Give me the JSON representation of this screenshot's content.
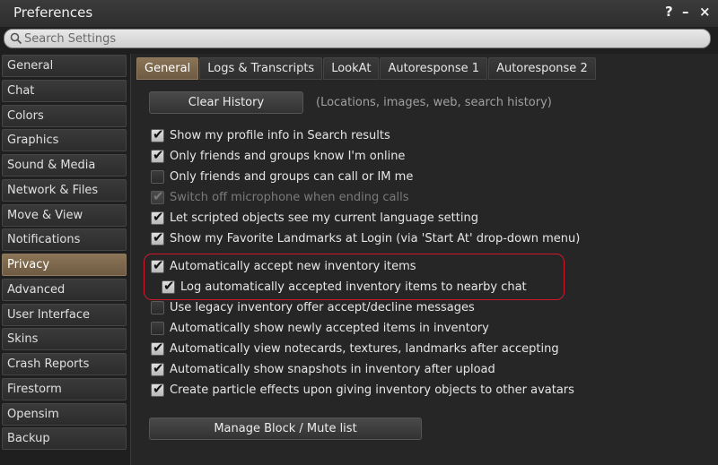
{
  "window": {
    "title": "Preferences",
    "controls": [
      "?",
      "–",
      "×"
    ]
  },
  "search": {
    "placeholder": "Search Settings"
  },
  "sidebar": {
    "items": [
      {
        "label": "General"
      },
      {
        "label": "Chat"
      },
      {
        "label": "Colors"
      },
      {
        "label": "Graphics"
      },
      {
        "label": "Sound & Media"
      },
      {
        "label": "Network & Files"
      },
      {
        "label": "Move & View"
      },
      {
        "label": "Notifications"
      },
      {
        "label": "Privacy",
        "active": true
      },
      {
        "label": "Advanced"
      },
      {
        "label": "User Interface"
      },
      {
        "label": "Skins"
      },
      {
        "label": "Crash Reports"
      },
      {
        "label": "Firestorm"
      },
      {
        "label": "Opensim"
      },
      {
        "label": "Backup"
      }
    ]
  },
  "tabs": [
    {
      "label": "General",
      "active": true
    },
    {
      "label": "Logs & Transcripts"
    },
    {
      "label": "LookAt"
    },
    {
      "label": "Autoresponse 1"
    },
    {
      "label": "Autoresponse 2"
    }
  ],
  "clear_history": {
    "label": "Clear History",
    "hint": "(Locations, images, web, search history)"
  },
  "options": [
    {
      "label": "Show my profile info in Search results",
      "checked": true
    },
    {
      "label": "Only friends and groups know I'm online",
      "checked": true
    },
    {
      "label": "Only friends and groups can call or IM me",
      "checked": false
    },
    {
      "label": "Switch off microphone when ending calls",
      "checked": true,
      "disabled": true
    },
    {
      "label": "Let scripted objects see my current language setting",
      "checked": true
    },
    {
      "label": "Show my Favorite Landmarks at Login (via 'Start At' drop-down menu)",
      "checked": true
    },
    {
      "label": "Automatically accept new inventory items",
      "checked": true
    },
    {
      "label": "Log automatically accepted inventory items to nearby chat",
      "checked": true
    },
    {
      "label": "Use legacy inventory offer accept/decline messages",
      "checked": false
    },
    {
      "label": "Automatically show newly accepted items in inventory",
      "checked": false
    },
    {
      "label": "Automatically view notecards, textures, landmarks after accepting",
      "checked": true
    },
    {
      "label": "Automatically show snapshots in inventory after upload",
      "checked": true
    },
    {
      "label": "Create particle effects upon giving inventory objects to other avatars",
      "checked": true
    }
  ],
  "manage_block": {
    "label": "Manage Block / Mute list"
  },
  "colors": {
    "accent": "#7d6a50",
    "highlight_border": "#d0182a"
  }
}
